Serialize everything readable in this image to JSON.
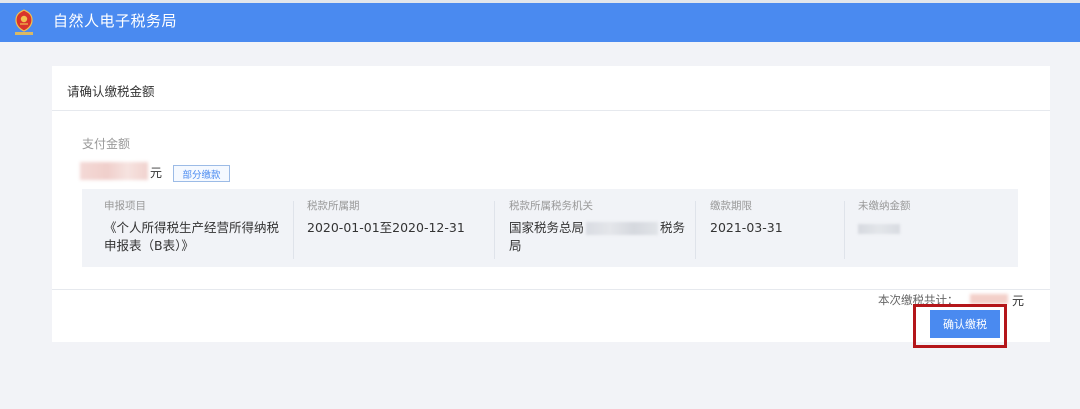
{
  "header": {
    "title": "自然人电子税务局",
    "bg_color": "#4a8af0",
    "logo_icon": "tax-emblem-icon"
  },
  "card": {
    "title": "请确认缴税金额",
    "pay_amount_label": "支付金额",
    "pay_amount_unit": "元",
    "partial_pay_button": "部分缴款",
    "columns": [
      {
        "header": "申报项目",
        "value": "《个人所得税生产经营所得纳税申报表（B表）》"
      },
      {
        "header": "税款所属期",
        "value": "2020-01-01至2020-12-31"
      },
      {
        "header": "税款所属税务机关",
        "value_prefix": "国家税务总局",
        "value_suffix": "税务局"
      },
      {
        "header": "缴款期限",
        "value": "2021-03-31"
      },
      {
        "header": "未缴纳金额",
        "value": ""
      }
    ],
    "total_label": "本次缴税共计：",
    "total_unit": "元",
    "confirm_button": "确认缴税",
    "accent_color": "#4a8af0",
    "highlight_color": "#b4161a"
  }
}
